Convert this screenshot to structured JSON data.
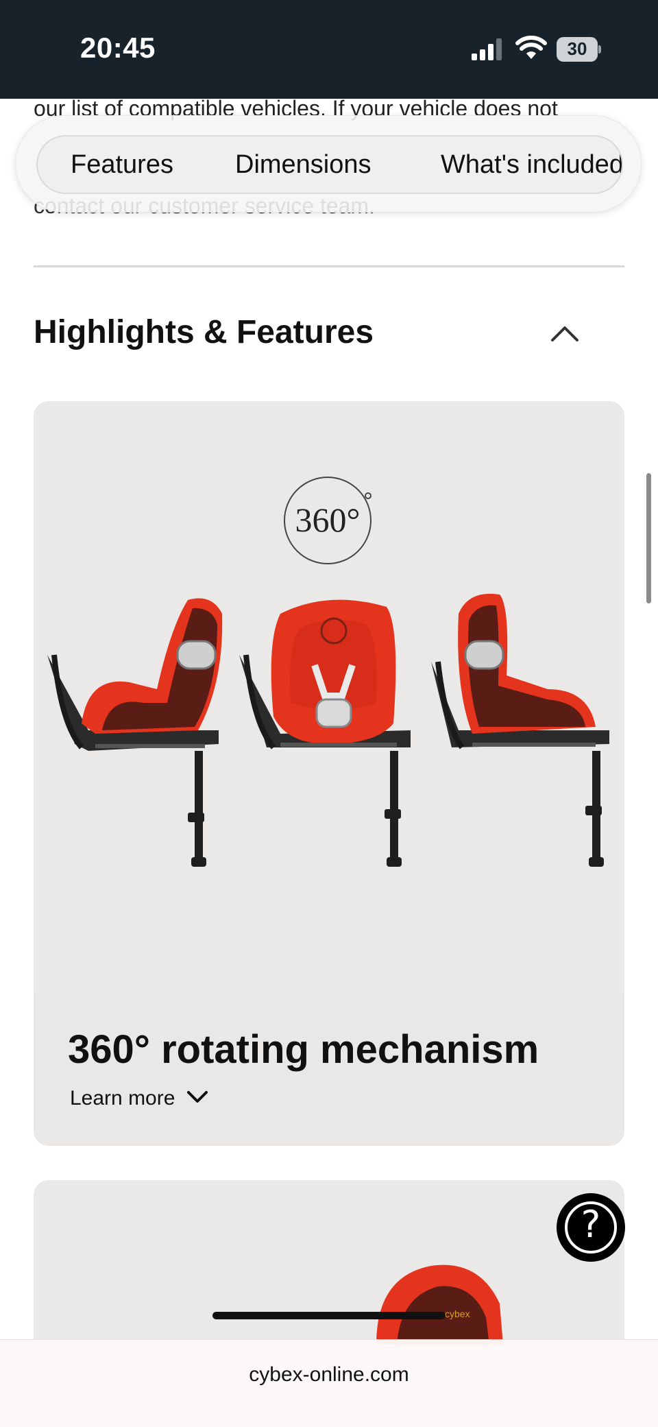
{
  "status_bar": {
    "time": "20:45",
    "battery_level": "30",
    "icons": [
      "signal-icon",
      "wifi-icon",
      "battery-icon"
    ]
  },
  "page": {
    "partial_text_top": "our list of compatible vehicles. If your vehicle does not",
    "partial_text_bottom": "contact our customer service team."
  },
  "pill_nav": {
    "tabs": [
      "Features",
      "Dimensions",
      "What's included"
    ]
  },
  "section": {
    "title": "Highlights & Features",
    "expanded": true
  },
  "feature_cards": [
    {
      "badge": "360°",
      "title": "360° rotating mechanism",
      "learn_more": "Learn more"
    },
    {
      "brand_mark": "cybex"
    }
  ],
  "help": {
    "label": "?"
  },
  "browser": {
    "url": "cybex-online.com"
  },
  "colors": {
    "status_bar_bg": "#18222b",
    "card_bg": "#ebe9e7",
    "seat_red": "#e5341e",
    "seat_dark": "#5a1d16"
  }
}
